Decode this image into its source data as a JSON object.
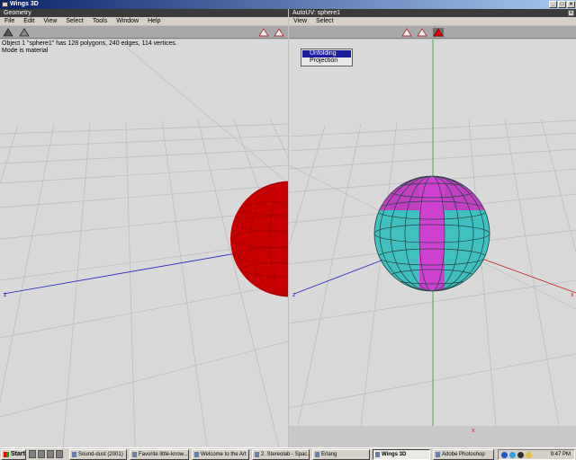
{
  "app_title": "Wings 3D",
  "window_buttons": {
    "minimize": "_",
    "maximize": "□",
    "close": "×"
  },
  "geometry": {
    "title": "Geometry",
    "menu": [
      "File",
      "Edit",
      "View",
      "Select",
      "Tools",
      "Window",
      "Help"
    ],
    "info_line1": "Object 1 \"sphere1\" has 128 polygons, 240 edges, 114 vertices.",
    "info_line2": "Mode is material",
    "axis_label_z": "z"
  },
  "autouv": {
    "title": "AutoUV: sphere1",
    "close": "×",
    "menu": [
      "View",
      "Select"
    ],
    "popup": [
      "Unfolding",
      "Projection"
    ],
    "axis_label_z": "z",
    "axis_label_x": "x",
    "axis_label_x_bottom": "x"
  },
  "colors": {
    "sphere_red": "#c80000",
    "uv_cyan": "#40c0c0",
    "uv_magenta": "#c040c0",
    "axis_blue": "#2020c0",
    "axis_red": "#c02020",
    "axis_green": "#20a020"
  },
  "taskbar": {
    "start": "Start",
    "tasks": [
      "Sound-dust (2001)",
      "Favorite little-know...",
      "Welcome to the Art ...",
      "2. Stereolab - Spac...",
      "Erlang",
      "Wings 3D",
      "Adobe Photoshop"
    ],
    "clock": "9:47 PM"
  }
}
